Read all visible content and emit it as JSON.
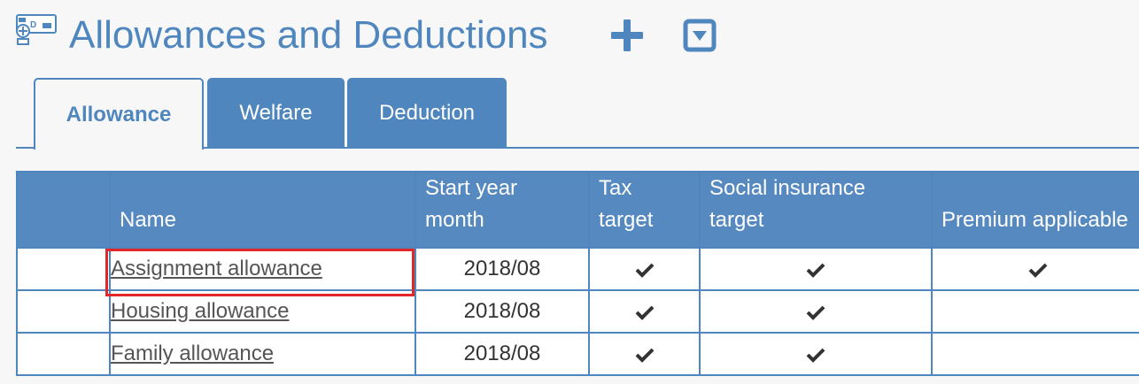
{
  "page": {
    "title": "Allowances and Deductions"
  },
  "icons": {
    "app": "allowance-card-icon",
    "add": "plus-icon",
    "dropdown": "dropdown-box-icon",
    "check": "checkmark-icon"
  },
  "tabs": [
    {
      "label": "Allowance",
      "active": true
    },
    {
      "label": "Welfare",
      "active": false
    },
    {
      "label": "Deduction",
      "active": false
    }
  ],
  "table": {
    "columns": [
      "",
      "Name",
      "Start year month",
      "Tax target",
      "Social insurance target",
      "Premium applicable"
    ],
    "rows": [
      {
        "name": "Assignment allowance",
        "start": "2018/08",
        "tax": true,
        "social": true,
        "premium": true
      },
      {
        "name": "Housing allowance",
        "start": "2018/08",
        "tax": true,
        "social": true,
        "premium": false
      },
      {
        "name": "Family allowance",
        "start": "2018/08",
        "tax": true,
        "social": true,
        "premium": false
      }
    ]
  },
  "colors": {
    "accent": "#4f86bd",
    "header_bg": "#5589bf",
    "highlight": "#e02828"
  }
}
